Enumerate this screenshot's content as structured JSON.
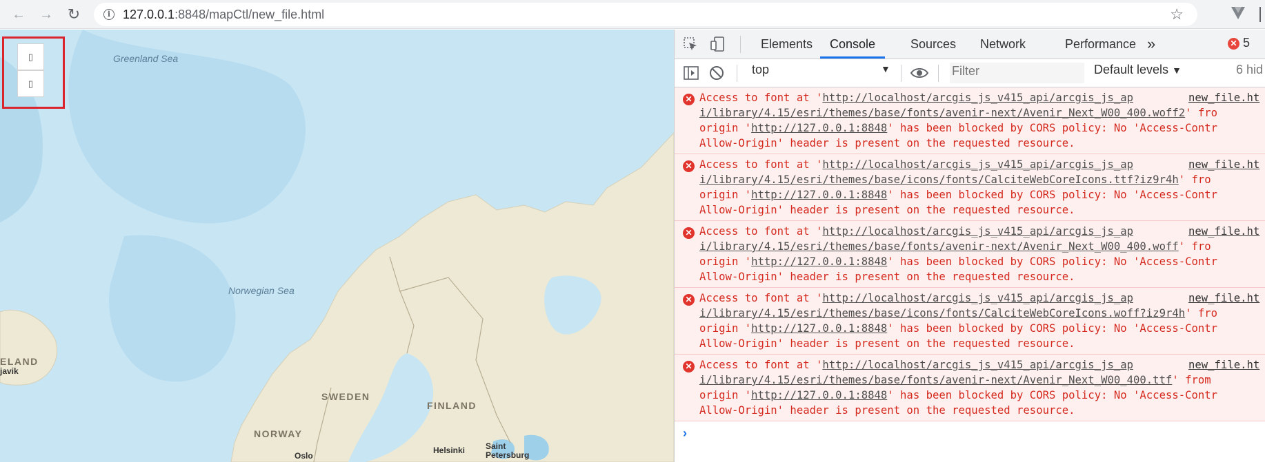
{
  "browser": {
    "url_host": "127.0.0.1",
    "url_rest": ":8848/mapCtl/new_file.html",
    "icons": {
      "back": "arrow-left-icon",
      "forward": "arrow-right-icon",
      "reload": "reload-icon",
      "info": "info-icon",
      "star": "star-icon",
      "extension": "vue-devtools-icon"
    }
  },
  "map": {
    "water_labels": [
      "Greenland Sea",
      "Norwegian Sea"
    ],
    "country_labels": [
      "SWEDEN",
      "FINLAND",
      "NORWAY",
      "ELAND"
    ],
    "city_labels": [
      "javik",
      "Oslo",
      "Helsinki",
      "Saint",
      "Petersburg"
    ],
    "controls": [
      {
        "name": "map-control-button-1",
        "glyph": "▯"
      },
      {
        "name": "map-control-button-2",
        "glyph": "▯"
      }
    ],
    "colors": {
      "water": "#c7e5f3",
      "deep_water": "#b3d9ed",
      "land": "#ede9d4",
      "highlight_frame": "#d9252b"
    }
  },
  "devtools": {
    "tabs": [
      "Elements",
      "Console",
      "Sources",
      "Network",
      "Performance"
    ],
    "active_tab": "Console",
    "more_tabs": "»",
    "error_count": "5",
    "context": "top",
    "filter_placeholder": "Filter",
    "levels": "Default levels",
    "hidden_text": "6 hid",
    "messages": [
      {
        "l1_pre": "Access to font at '",
        "l1_url": "http://localhost/arcgis_js_v415_api/arcgis_js_ap",
        "l2_url": "i/library/4.15/esri/themes/base/fonts/avenir-next/Avenir_Next_W00_400.woff2",
        "l2_post": "' fro",
        "l3_pre": "origin '",
        "l3_url": "http://127.0.0.1:8848",
        "l3_post": "' has been blocked by CORS policy: No 'Access-Contr",
        "l4": "Allow-Origin' header is present on the requested resource.",
        "source": "new_file.ht"
      },
      {
        "l1_pre": "Access to font at '",
        "l1_url": "http://localhost/arcgis_js_v415_api/arcgis_js_ap",
        "l2_url": "i/library/4.15/esri/themes/base/icons/fonts/CalciteWebCoreIcons.ttf?iz9r4h",
        "l2_post": "' fro",
        "l3_pre": "origin '",
        "l3_url": "http://127.0.0.1:8848",
        "l3_post": "' has been blocked by CORS policy: No 'Access-Contr",
        "l4": "Allow-Origin' header is present on the requested resource.",
        "source": "new_file.ht"
      },
      {
        "l1_pre": "Access to font at '",
        "l1_url": "http://localhost/arcgis_js_v415_api/arcgis_js_ap",
        "l2_url": "i/library/4.15/esri/themes/base/fonts/avenir-next/Avenir_Next_W00_400.woff",
        "l2_post": "' fro",
        "l3_pre": "origin '",
        "l3_url": "http://127.0.0.1:8848",
        "l3_post": "' has been blocked by CORS policy: No 'Access-Contr",
        "l4": "Allow-Origin' header is present on the requested resource.",
        "source": "new_file.ht"
      },
      {
        "l1_pre": "Access to font at '",
        "l1_url": "http://localhost/arcgis_js_v415_api/arcgis_js_ap",
        "l2_url": "i/library/4.15/esri/themes/base/icons/fonts/CalciteWebCoreIcons.woff?iz9r4h",
        "l2_post": "' fro",
        "l3_pre": "origin '",
        "l3_url": "http://127.0.0.1:8848",
        "l3_post": "' has been blocked by CORS policy: No 'Access-Contr",
        "l4": "Allow-Origin' header is present on the requested resource.",
        "source": "new_file.ht"
      },
      {
        "l1_pre": "Access to font at '",
        "l1_url": "http://localhost/arcgis_js_v415_api/arcgis_js_ap",
        "l2_url": "i/library/4.15/esri/themes/base/fonts/avenir-next/Avenir_Next_W00_400.ttf",
        "l2_post": "' from",
        "l3_pre": "origin '",
        "l3_url": "http://127.0.0.1:8848",
        "l3_post": "' has been blocked by CORS policy: No 'Access-Contr",
        "l4": "Allow-Origin' header is present on the requested resource.",
        "source": "new_file.ht"
      }
    ],
    "prompt": "›"
  }
}
